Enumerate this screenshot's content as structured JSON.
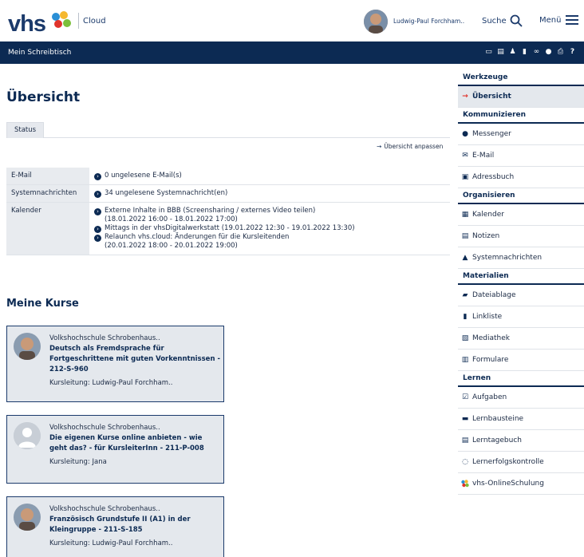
{
  "header": {
    "logo": "vhs",
    "cloud_label": "Cloud",
    "user_name": "Ludwig-Paul Forchham..",
    "search_label": "Suche",
    "menu_label": "Menü"
  },
  "navbar": {
    "title": "Mein Schreibtisch",
    "icons": [
      "screen-icon",
      "window-icon",
      "person-icon",
      "bookmark-icon",
      "link-icon",
      "location-icon",
      "print-icon",
      "help-icon"
    ]
  },
  "main": {
    "title": "Übersicht",
    "tab": "Status",
    "customize_label": "Übersicht anpassen",
    "status": {
      "email_label": "E-Mail",
      "email_value": "0 ungelesene E-Mail(s)",
      "sys_label": "Systemnachrichten",
      "sys_value": "34 ungelesene Systemnachricht(en)",
      "cal_label": "Kalender",
      "cal_items": [
        {
          "title": "Externe Inhalte in BBB (Screensharing / externes Video teilen)",
          "time": "(18.01.2022 16:00 - 18.01.2022 17:00)"
        },
        {
          "title": "Mittags in der vhsDigitalwerkstatt (19.01.2022 12:30 - 19.01.2022 13:30)",
          "time": ""
        },
        {
          "title": "Relaunch vhs.cloud: Änderungen für die Kursleitenden",
          "time": "(20.01.2022 18:00 - 20.01.2022 19:00)"
        }
      ]
    },
    "courses_title": "Meine Kurse",
    "courses": [
      {
        "org": "Volkshochschule Schrobenhaus..",
        "title": "Deutsch als Fremdsprache für Fortgeschrittene mit guten Vorkenntnissen - 212-S-960",
        "lead": "Kursleitung: Ludwig-Paul Forchham.."
      },
      {
        "org": "Volkshochschule Schrobenhaus..",
        "title": "Die eigenen Kurse online anbieten - wie geht das? - für KursleiterInn - 211-P-008",
        "lead": "Kursleitung: Jana"
      },
      {
        "org": "Volkshochschule Schrobenhaus..",
        "title": "Französisch Grundstufe II (A1) in der Kleingruppe - 211-S-185",
        "lead": "Kursleitung: Ludwig-Paul Forchham.."
      }
    ]
  },
  "sidebar": {
    "tools_title": "Werkzeuge",
    "overview": "Übersicht",
    "g1": "Kommunizieren",
    "messenger": "Messenger",
    "email": "E-Mail",
    "addressbook": "Adressbuch",
    "g2": "Organisieren",
    "calendar": "Kalender",
    "notes": "Notizen",
    "sysmsg": "Systemnachrichten",
    "g3": "Materialien",
    "files": "Dateiablage",
    "links": "Linkliste",
    "media": "Mediathek",
    "forms": "Formulare",
    "g4": "Lernen",
    "tasks": "Aufgaben",
    "modules": "Lernbausteine",
    "diary": "Lerntagebuch",
    "quiz": "Lernerfolgskontrolle",
    "online": "vhs-OnlineSchulung"
  },
  "colors": {
    "navy": "#0c2a53",
    "accent_red": "#e0342c",
    "panel": "#e4e8ed"
  }
}
